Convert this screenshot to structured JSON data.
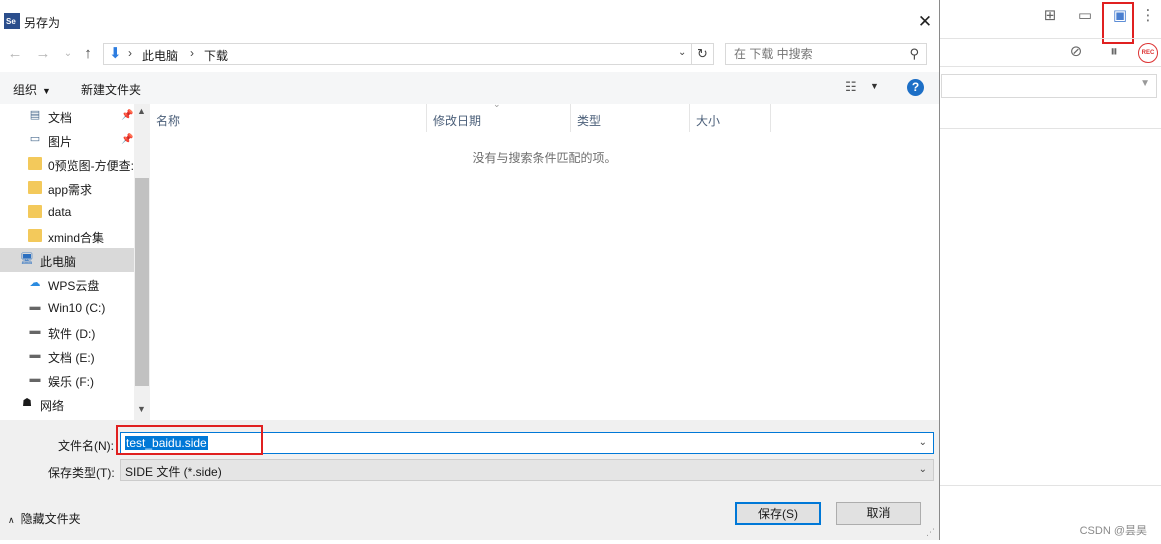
{
  "dialog": {
    "title": "另存为",
    "app_icon_text": "Se",
    "close": "✕"
  },
  "address": {
    "back": "←",
    "forward": "→",
    "recent": "⌄",
    "up": "↑",
    "crumbs": [
      "此电脑",
      "下载"
    ],
    "separator": "›",
    "dropdown": "⌄",
    "refresh": "↻"
  },
  "search": {
    "placeholder": "在 下载 中搜索",
    "icon": "⚲"
  },
  "toolbar": {
    "organize": "组织",
    "organize_caret": "▼",
    "new_folder": "新建文件夹",
    "view_icon": "☷",
    "view_caret": "▼",
    "help": "?"
  },
  "nav": {
    "items": [
      {
        "label": "文档",
        "icon": "document-icon",
        "glyph": "▤",
        "pinned": true
      },
      {
        "label": "图片",
        "icon": "picture-icon",
        "glyph": "▭",
        "pinned": true
      },
      {
        "label": "0预览图-方便查:",
        "icon": "folder-icon",
        "glyph": "",
        "pinned": false
      },
      {
        "label": "app需求",
        "icon": "folder-icon",
        "glyph": "",
        "pinned": false
      },
      {
        "label": "data",
        "icon": "folder-icon",
        "glyph": "",
        "pinned": false
      },
      {
        "label": "xmind合集",
        "icon": "folder-icon",
        "glyph": "",
        "pinned": false
      },
      {
        "label": "此电脑",
        "icon": "computer-icon",
        "glyph": "🖥",
        "pinned": false,
        "selected": true
      },
      {
        "label": "WPS云盘",
        "icon": "cloud-icon",
        "glyph": "☁",
        "pinned": false
      },
      {
        "label": "Win10 (C:)",
        "icon": "windows-drive-icon",
        "glyph": "▬",
        "pinned": false
      },
      {
        "label": "软件 (D:)",
        "icon": "drive-icon",
        "glyph": "▬",
        "pinned": false
      },
      {
        "label": "文档 (E:)",
        "icon": "drive-icon",
        "glyph": "▬",
        "pinned": false
      },
      {
        "label": "娱乐 (F:)",
        "icon": "drive-icon",
        "glyph": "▬",
        "pinned": false
      },
      {
        "label": "网络",
        "icon": "network-icon",
        "glyph": "☗",
        "pinned": false
      }
    ],
    "pin_glyph": "📌",
    "scroll_up": "▲",
    "scroll_down": "▼"
  },
  "columns": [
    "名称",
    "修改日期",
    "类型",
    "大小"
  ],
  "sort_caret": "⌄",
  "empty_message": "没有与搜索条件匹配的项。",
  "filename": {
    "label": "文件名(N):",
    "value": "test_baidu.side",
    "dropdown": "⌄"
  },
  "filetype": {
    "label": "保存类型(T):",
    "value": "SIDE 文件 (*.side)",
    "dropdown": "⌄"
  },
  "hide_folders": {
    "caret": "∧",
    "label": "隐藏文件夹"
  },
  "buttons": {
    "save": "保存(S)",
    "cancel": "取消"
  },
  "background_app": {
    "icons": [
      "new-folder-icon",
      "open-folder-icon",
      "save-icon",
      "more-icon",
      "disable-breakpoints-icon",
      "pause-icon",
      "record-icon"
    ],
    "rec_label": "REC",
    "watermark": "CSDN @昙昊"
  },
  "colors": {
    "accent": "#0078d7",
    "highlight_box": "#e02020",
    "help": "#1d6fc6"
  }
}
